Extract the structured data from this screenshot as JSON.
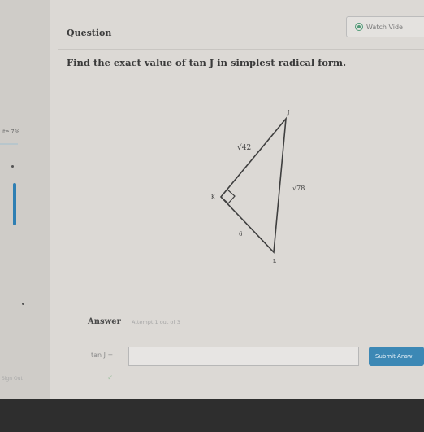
{
  "sidebar": {
    "progress_label": "ite 7%",
    "hint_text": "Sign Out"
  },
  "header": {
    "title": "Question",
    "watch_video_label": "Watch Vide"
  },
  "question": {
    "prompt": "Find the exact value of tan J in simplest radical form."
  },
  "diagram": {
    "vertices": [
      "J",
      "K",
      "L"
    ],
    "hypotenuse_label": "√78",
    "side_jk_label": "√42",
    "side_kl_label": "6",
    "right_angle_at": "K"
  },
  "answer": {
    "label": "Answer",
    "attempt_text": "Attempt 1 out of 3",
    "equation_label": "tan J =",
    "input_value": "",
    "submit_label": "Submit Answ"
  },
  "colors": {
    "accent": "#3c88b5",
    "rail_bar": "#2f7fb3",
    "watch_icon": "#4f9a76"
  }
}
